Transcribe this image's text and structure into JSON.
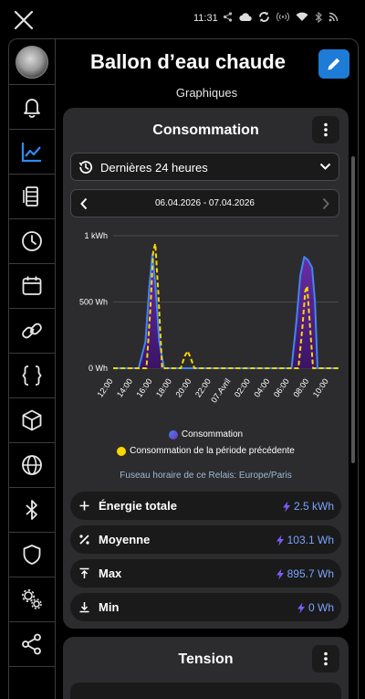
{
  "status_bar": {
    "time": "11:31",
    "icons": [
      "share-icon",
      "cloud-icon",
      "sync-icon",
      "hotspot-icon",
      "wifi-icon",
      "bluetooth-icon",
      "rss-icon"
    ]
  },
  "sidebar": {
    "items": [
      "avatar",
      "bell-icon",
      "chart-icon",
      "device-list-icon",
      "clock-icon",
      "calendar-icon",
      "link-icon",
      "code-braces-icon",
      "cube-icon",
      "globe-icon",
      "bluetooth-icon",
      "shield-icon",
      "gears-icon",
      "share-nodes-icon"
    ],
    "active_item": "chart-icon"
  },
  "header": {
    "title": "Ballon d’eau chaude",
    "subtitle": "Graphiques"
  },
  "consumption_card": {
    "title": "Consommation",
    "period_select": "Dernières 24 heures",
    "date_range": "06.04.2026 - 07.04.2026",
    "timezone_note": "Fuseau horaire de ce Relais: Europe/Paris",
    "stats": [
      {
        "icon": "plus-icon",
        "label": "Énergie totale",
        "value": "2.5 kWh"
      },
      {
        "icon": "percent-icon",
        "label": "Moyenne",
        "value": "103.1 Wh"
      },
      {
        "icon": "max-icon",
        "label": "Max",
        "value": "895.7 Wh"
      },
      {
        "icon": "min-icon",
        "label": "Min",
        "value": "0 Wh"
      }
    ]
  },
  "voltage_card": {
    "title": "Tension"
  },
  "colors": {
    "accent": "#1e7bd6",
    "current_series": "#3f86f0",
    "current_fill": "#5a1e8c",
    "previous_series": "#ffd600",
    "value_text": "#7aa3ff"
  },
  "chart_data": {
    "type": "area",
    "x_ticks": [
      "12:00",
      "14:00",
      "16:00",
      "18:00",
      "20:00",
      "22:00",
      "07.Avril",
      "02:00",
      "04:00",
      "06:00",
      "08:00",
      "10:00"
    ],
    "y_ticks": [
      "1 kWh",
      "500 Wh",
      "0 Wh"
    ],
    "ylim": [
      0,
      1000
    ],
    "y_unit": "Wh",
    "grid": true,
    "legend_position": "bottom",
    "series": [
      {
        "name": "Consommation",
        "style": "solid-filled",
        "points": [
          [
            12,
            0
          ],
          [
            14.6,
            0
          ],
          [
            15.3,
            200
          ],
          [
            15.7,
            620
          ],
          [
            16.0,
            860
          ],
          [
            16.3,
            640
          ],
          [
            16.7,
            200
          ],
          [
            17.2,
            0
          ],
          [
            30.2,
            0
          ],
          [
            30.7,
            350
          ],
          [
            31.1,
            700
          ],
          [
            31.5,
            840
          ],
          [
            31.9,
            815
          ],
          [
            32.3,
            760
          ],
          [
            32.6,
            500
          ],
          [
            32.85,
            0
          ],
          [
            35,
            0
          ]
        ]
      },
      {
        "name": "Consommation de la période précédente",
        "style": "dashed",
        "points": [
          [
            12,
            0
          ],
          [
            15.4,
            0
          ],
          [
            15.8,
            450
          ],
          [
            16.1,
            890
          ],
          [
            16.3,
            940
          ],
          [
            16.6,
            580
          ],
          [
            17.0,
            0
          ],
          [
            18.9,
            0
          ],
          [
            19.3,
            90
          ],
          [
            19.6,
            130
          ],
          [
            19.9,
            80
          ],
          [
            20.3,
            0
          ],
          [
            30.9,
            0
          ],
          [
            31.3,
            300
          ],
          [
            31.6,
            580
          ],
          [
            31.8,
            620
          ],
          [
            32.1,
            300
          ],
          [
            32.4,
            0
          ],
          [
            35,
            0
          ]
        ]
      }
    ]
  }
}
